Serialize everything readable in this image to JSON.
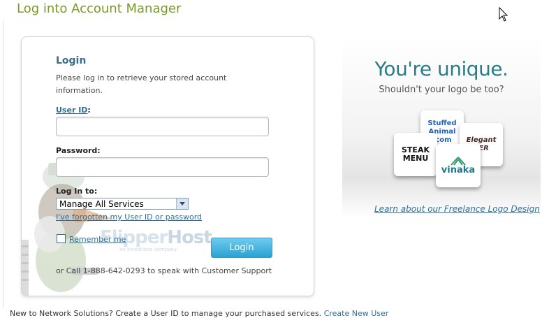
{
  "page": {
    "title": "Log into Account Manager"
  },
  "login": {
    "heading": "Login",
    "intro": "Please log in to retrieve your stored account information.",
    "user_id_label": "User ID",
    "user_id_colon": ":",
    "user_id_value": "",
    "password_label": "Password:",
    "password_value": "",
    "login_to_label": "Log In to:",
    "login_to_selected": "Manage All Services",
    "forgot_link": "I've forgotten my User ID or password",
    "remember_label": "Remember me",
    "remember_checked": false,
    "login_button": "Login",
    "support_text": "or Call 1-888-642-0293 to speak with Customer Support",
    "watermark_brand": "Flipper",
    "watermark_brand2": "Host",
    "watermark_tagline": "an investition company"
  },
  "ad": {
    "headline": "You're unique.",
    "subline": "Shouldn't your logo be too?",
    "tiles": [
      "Stuffed Animal .com",
      "Elegant SER",
      "STEAK MENU",
      "vinaka"
    ],
    "link": "Learn about our Freelance Logo Design"
  },
  "footer": {
    "text": "New to Network Solutions? Create a User ID to manage your purchased services. ",
    "link": "Create New User"
  },
  "colors": {
    "title": "#7a9a2a",
    "heading": "#3a6e86",
    "link": "#2f6f96",
    "button": "#2aa2d3",
    "ad_headline": "#2a7d86"
  }
}
